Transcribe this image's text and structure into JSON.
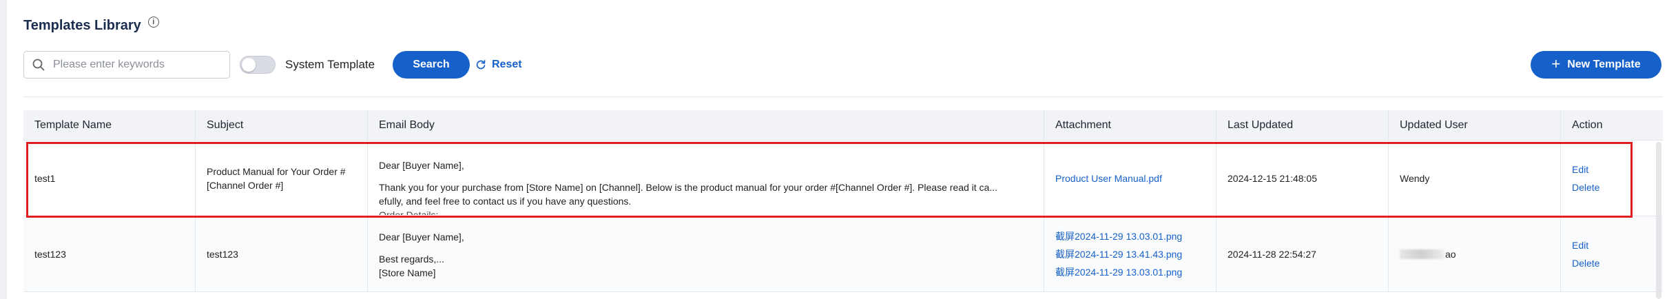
{
  "page": {
    "title": "Templates Library",
    "info_icon": "info-icon"
  },
  "toolbar": {
    "search_placeholder": "Please enter keywords",
    "search_icon": "search-icon",
    "toggle_label": "System Template",
    "toggle_on": false,
    "search_button": "Search",
    "reset_button": "Reset",
    "new_button": "New Template",
    "accent_color": "#1660c9"
  },
  "table": {
    "columns": [
      "Template Name",
      "Subject",
      "Email Body",
      "Attachment",
      "Last Updated",
      "Updated User",
      "Action"
    ],
    "rows": [
      {
        "name": "test1",
        "subject": "Product Manual for Your Order # [Channel Order #]",
        "body_line1": "Dear [Buyer Name],",
        "body_line2": "Thank you for your purchase from [Store Name] on [Channel]. Below is the product manual for your order #[Channel Order #]. Please read it ca...",
        "body_line3": "efully, and feel free to contact us if you have any questions.",
        "body_line4": "Order Details:",
        "attachments": [
          "Product User Manual.pdf"
        ],
        "last_updated": "2024-12-15 21:48:05",
        "updated_user": "Wendy",
        "edit": "Edit",
        "delete": "Delete"
      },
      {
        "name": "test123",
        "subject": "test123",
        "body_line1": "Dear [Buyer Name],",
        "body_line2": "Best regards,...",
        "body_line3": "[Store Name]",
        "attachments": [
          "截屏2024-11-29 13.03.01.png",
          "截屏2024-11-29 13.41.43.png",
          "截屏2024-11-29 13.03.01.png"
        ],
        "last_updated": "2024-11-28 22:54:27",
        "updated_user": "ao",
        "edit": "Edit",
        "delete": "Delete"
      }
    ]
  },
  "highlight_color": "#e02020"
}
